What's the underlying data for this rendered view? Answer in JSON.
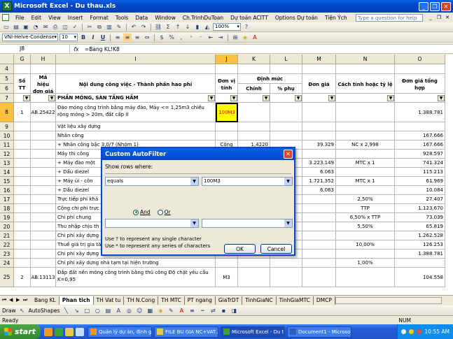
{
  "window": {
    "title": "Microsoft Excel - Du thau.xls"
  },
  "menu": [
    "File",
    "Edit",
    "View",
    "Insert",
    "Format",
    "Tools",
    "Data",
    "Window",
    "Ch.TrinhDuToan",
    "Dự toán ACITT",
    "Options Dự toán",
    "Tiện Ých"
  ],
  "help_placeholder": "Type a question for help",
  "toolbar1": {
    "zoom": "100%"
  },
  "toolbar2": {
    "font": "VNI-Helve-Condense",
    "size": "10"
  },
  "formula": {
    "cell_ref": "J8",
    "fx": "fx",
    "value": "=Bang KL!K8"
  },
  "columns": [
    "G",
    "H",
    "I",
    "J",
    "K",
    "L",
    "M",
    "N",
    "O"
  ],
  "header": {
    "stt": "Số TT",
    "ma_hieu": "Mã hiệu đơn giá",
    "noi_dung": "Nội dung công việc - Thành phần hao phí",
    "don_vi": "Đơn vị tính",
    "dinh_muc": "Định mức",
    "chinh": "Chính",
    "phu": "% phụ",
    "don_gia": "Đơn giá",
    "cach_tinh": "Cách tính hoặc tỷ lệ",
    "tong_hop": "Đơn giá tổng hợp"
  },
  "rows": [
    {
      "r": "7",
      "g": "",
      "h": "",
      "i": "PHẦN MÓNG, SÀN TẦNG HẦM",
      "j": "",
      "k": "",
      "l": "",
      "m": "",
      "n": "",
      "o": ""
    },
    {
      "r": "8",
      "g": "1",
      "h": "AB.25422",
      "i": "Đào móng công trình bằng máy đào, Máy <= 1,25m3 chiều rộng móng > 20m, đất cấp II",
      "j": "100M3",
      "k": "",
      "l": "",
      "m": "",
      "n": "",
      "o": "1.388.781"
    },
    {
      "r": "9",
      "g": "",
      "h": "",
      "i": "Vật liệu xây dựng",
      "j": "",
      "k": "",
      "l": "",
      "m": "",
      "n": "",
      "o": ""
    },
    {
      "r": "10",
      "g": "",
      "h": "",
      "i": "Nhân công",
      "j": "",
      "k": "",
      "l": "",
      "m": "",
      "n": "",
      "o": "167.666"
    },
    {
      "r": "11",
      "g": "",
      "h": "",
      "i": "+ Nhân công bậc 3,0/7 (Nhóm 1)",
      "j": "Công",
      "k": "1,4220",
      "l": "",
      "m": "39.329",
      "n": "NC x 2,998",
      "o": "167.666"
    },
    {
      "r": "12",
      "g": "",
      "h": "",
      "i": "Máy thi công",
      "j": "",
      "k": "",
      "l": "",
      "m": "",
      "n": "",
      "o": "928.597"
    },
    {
      "r": "13",
      "g": "",
      "h": "",
      "i": "+ Máy đào một",
      "j": "",
      "k": "",
      "l": "",
      "m": "3.223.149",
      "n": "MTC x 1",
      "o": "741.324"
    },
    {
      "r": "14",
      "g": "",
      "h": "",
      "i": "+ Dầu diezel",
      "j": "",
      "k": "",
      "l": "",
      "m": "6.063",
      "n": "",
      "o": "115.213"
    },
    {
      "r": "15",
      "g": "",
      "h": "",
      "i": "+ Máy ủi - côn",
      "j": "",
      "k": "",
      "l": "",
      "m": "1.721.352",
      "n": "MTC x 1",
      "o": "61.969"
    },
    {
      "r": "16",
      "g": "",
      "h": "",
      "i": "+ Dầu diezel",
      "j": "",
      "k": "",
      "l": "",
      "m": "6.063",
      "n": "",
      "o": "10.084"
    },
    {
      "r": "17",
      "g": "",
      "h": "",
      "i": "Trực tiếp phí khá",
      "j": "",
      "k": "",
      "l": "",
      "m": "",
      "n": "2,50%",
      "o": "27.407"
    },
    {
      "r": "18",
      "g": "",
      "h": "",
      "i": "Cộng chi phí trực",
      "j": "",
      "k": "",
      "l": "",
      "m": "",
      "n": "TTP",
      "o": "1.123.670"
    },
    {
      "r": "19",
      "g": "",
      "h": "",
      "i": "Chi phí chung",
      "j": "",
      "k": "",
      "l": "",
      "m": "",
      "n": "6,50% x TTP",
      "o": "73.039"
    },
    {
      "r": "20",
      "g": "",
      "h": "",
      "i": "Thu nhập chịu th",
      "j": "",
      "k": "",
      "l": "",
      "m": "",
      "n": "5,50%",
      "o": "65.819"
    },
    {
      "r": "21",
      "g": "",
      "h": "",
      "i": "Chi phí xây dựng",
      "j": "",
      "k": "",
      "l": "",
      "m": "",
      "n": "",
      "o": "1.262.528"
    },
    {
      "r": "22",
      "g": "",
      "h": "",
      "i": "Thuế giá trị gia tă",
      "j": "",
      "k": "",
      "l": "",
      "m": "",
      "n": "10,00%",
      "o": "126.253"
    },
    {
      "r": "23",
      "g": "",
      "h": "",
      "i": "Chi phí xây dựng",
      "j": "",
      "k": "",
      "l": "",
      "m": "",
      "n": "",
      "o": "1.388.781"
    },
    {
      "r": "24",
      "g": "",
      "h": "",
      "i": "Chi phí xây dựng nhà tạm tại hiện trường",
      "j": "",
      "k": "",
      "l": "",
      "m": "",
      "n": "1,00%",
      "o": ""
    },
    {
      "r": "25",
      "g": "2",
      "h": "AB.13113",
      "i": "Đắp đất nền móng công trình bằng thủ công Độ chặt yêu cầu K=0,95",
      "j": "M3",
      "k": "",
      "l": "",
      "m": "",
      "n": "",
      "o": "104.558"
    }
  ],
  "row_headers_top": [
    "4",
    "5",
    "6"
  ],
  "sheets": [
    "Bang KL",
    "Phan tich",
    "TH Vat tu",
    "TH N.Cong",
    "TH MTC",
    "PT ngang",
    "GiaTrDT",
    "TinhGiaNC",
    "TinhGiaMTC",
    "DMCP"
  ],
  "drawbar": {
    "draw": "Draw",
    "autoshapes": "AutoShapes"
  },
  "status": {
    "left": "Ready",
    "num": "NUM"
  },
  "taskbar": {
    "start": "start",
    "tasks": [
      "Quản lý dự án, định g...",
      "FILE BU GIA NC+VAT...",
      "Microsoft Excel - Du t...",
      "Document1 - Microsof..."
    ],
    "clock": "10:55 AM"
  },
  "dialog": {
    "title": "Custom AutoFilter",
    "show_rows": "Show rows where:",
    "op1": "equals",
    "val1": "100M3",
    "and_label": "And",
    "or_label": "Or",
    "hint1": "Use ? to represent any single character",
    "hint2": "Use * to represent any series of characters",
    "ok": "OK",
    "cancel": "Cancel"
  }
}
